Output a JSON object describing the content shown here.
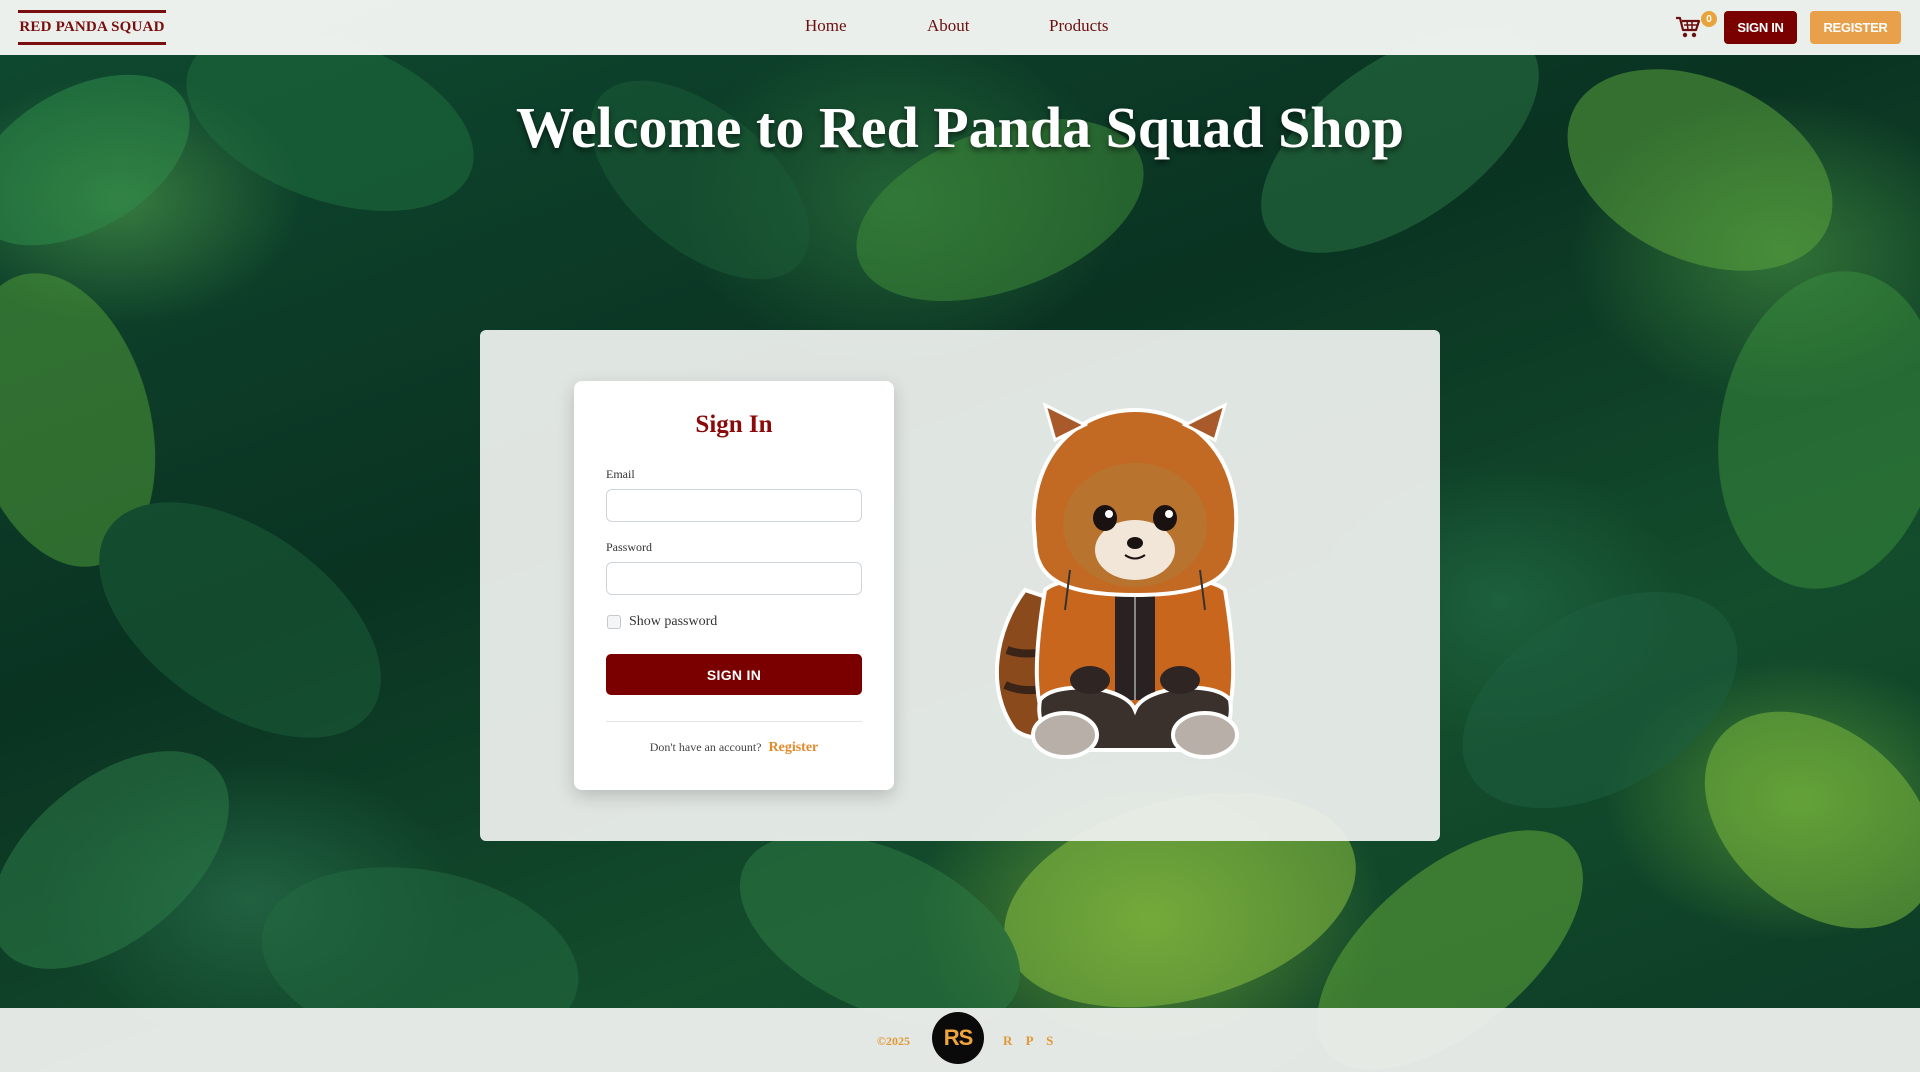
{
  "navbar": {
    "brand": "RED PANDA SQUAD",
    "links": [
      "Home",
      "About",
      "Products"
    ],
    "cart_count": "0",
    "sign_in_label": "SIGN IN",
    "register_label": "REGISTER"
  },
  "hero": {
    "title": "Welcome to Red Panda Squad Shop"
  },
  "signin_form": {
    "title": "Sign In",
    "email_label": "Email",
    "email_value": "",
    "password_label": "Password",
    "password_value": "",
    "show_password_label": "Show password",
    "show_password_checked": false,
    "submit_label": "SIGN IN",
    "no_account_text": "Don't have an account?",
    "register_link": "Register"
  },
  "footer": {
    "copyright": "©2025",
    "logo_text": "RS",
    "tagline": "R P S"
  },
  "icons": {
    "cart": "cart-icon",
    "mascot": "red-panda-mascot-image"
  },
  "colors": {
    "primary": "#7a0000",
    "accent": "#e8a04a",
    "brand_text": "#7a0d0d"
  }
}
